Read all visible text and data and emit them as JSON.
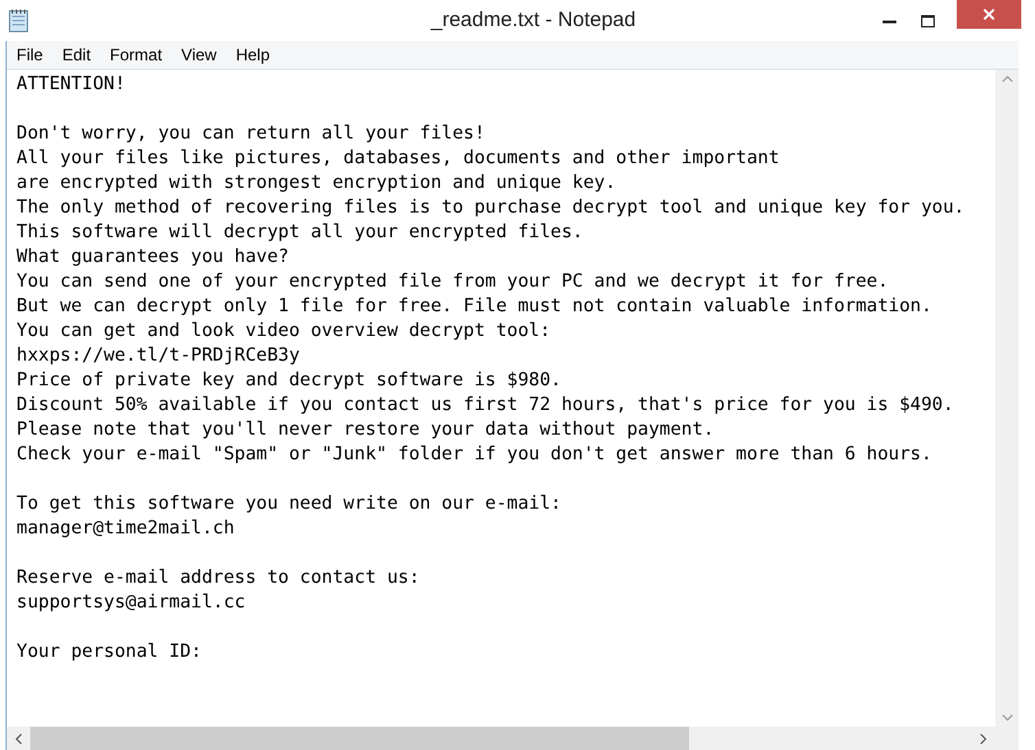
{
  "window": {
    "title": "_readme.txt - Notepad"
  },
  "menu": [
    "File",
    "Edit",
    "Format",
    "View",
    "Help"
  ],
  "document": {
    "blocks": [
      [
        "ATTENTION!"
      ],
      [
        "Don't worry, you can return all your files!",
        "All your files like pictures, databases, documents and other important",
        "are encrypted with strongest encryption and unique key.",
        "The only method of recovering files is to purchase decrypt tool and unique key for you.",
        "This software will decrypt all your encrypted files.",
        "What guarantees you have?",
        "You can send one of your encrypted file from your PC and we decrypt it for free.",
        "But we can decrypt only 1 file for free. File must not contain valuable information.",
        "You can get and look video overview decrypt tool:",
        "hxxps://we.tl/t-PRDjRCeB3y",
        "Price of private key and decrypt software is $980.",
        "Discount 50% available if you contact us first 72 hours, that's price for you is $490.",
        "Please note that you'll never restore your data without payment.",
        "Check your e-mail \"Spam\" or \"Junk\" folder if you don't get answer more than 6 hours."
      ],
      [
        "To get this software you need write on our e-mail:",
        "manager@time2mail.ch"
      ],
      [
        "Reserve e-mail address to contact us:",
        "supportsys@airmail.cc"
      ],
      [
        "Your personal ID:"
      ]
    ]
  }
}
